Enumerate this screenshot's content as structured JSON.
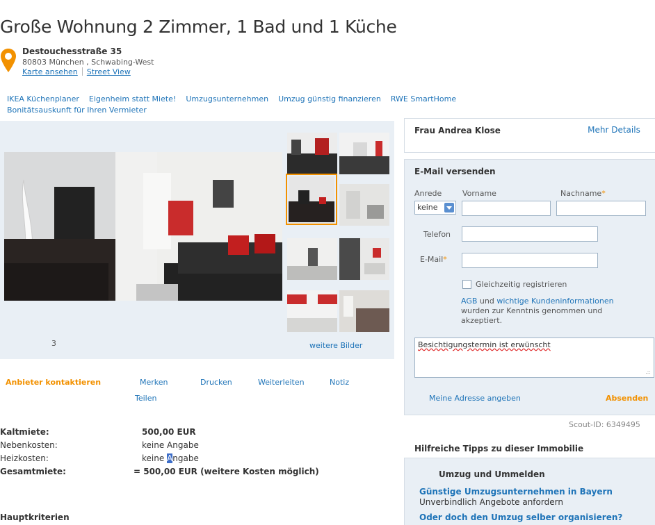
{
  "listing": {
    "title": "Große Wohnung 2 Zimmer, 1 Bad und 1 Küche",
    "street": "Destouchesstraße 35",
    "zip_city": "80803 München , Schwabing-West",
    "map_link": "Karte ansehen",
    "streetview_link": "Street View"
  },
  "promo_links": [
    "IKEA Küchenplaner",
    "Eigenheim statt Miete!",
    "Umzugsunternehmen",
    "Umzug günstig finanzieren",
    "RWE SmartHome",
    "Bonitätsauskunft für Ihren Vermieter"
  ],
  "gallery": {
    "counter": "3",
    "more_label": "weitere Bilder"
  },
  "actions": {
    "contact": "Anbieter kontaktieren",
    "remember": "Merken",
    "print": "Drucken",
    "forward": "Weiterleiten",
    "note": "Notiz",
    "share": "Teilen"
  },
  "facts": [
    {
      "label": "Kaltmiete:",
      "value": "500,00 EUR",
      "bold": true
    },
    {
      "label": "Nebenkosten:",
      "value": "keine Angabe",
      "bold": false
    },
    {
      "label": "Heizkosten:",
      "value_pre": "keine ",
      "value_hl": "A",
      "value_post": "ngabe",
      "bold": false
    },
    {
      "label": "Gesamtmiete:",
      "value": "= 500,00 EUR (weitere Kosten möglich)",
      "bold": true
    }
  ],
  "hauptkriterien": "Hauptkriterien",
  "agent": {
    "name": "Frau Andrea Klose",
    "details_link": "Mehr Details"
  },
  "contact_form": {
    "title": "E-Mail versenden",
    "salutation_label": "Anrede",
    "salutation_value": "keine",
    "firstname_label": "Vorname",
    "lastname_label": "Nachname",
    "required_mark": "*",
    "phone_label": "Telefon",
    "email_label": "E-Mail",
    "register_label": "Gleichzeitig registrieren",
    "agb_link": "AGB",
    "agb_and": " und ",
    "customer_info_link": "wichtige Kundeninformationen",
    "agb_rest": "wurden zur Kenntnis genommen und akzeptiert.",
    "message": "Besichtigungstermin ist erwünscht",
    "my_address_link": "Meine Adresse angeben",
    "send_button": "Absenden"
  },
  "scout_id": "Scout-ID: 6349495",
  "tips": {
    "heading": "Hilfreiche Tipps zu dieser Immobilie",
    "subheading": "Umzug und Ummelden",
    "tip1_link": "Günstige Umzugsunternehmen in Bayern",
    "tip1_text": "Unverbindlich Angebote anfordern",
    "tip2_link": "Oder doch den Umzug selber organisieren?"
  },
  "colors": {
    "link": "#1f74b8",
    "accent": "#f29100",
    "panel_bg": "#e9eff5"
  }
}
